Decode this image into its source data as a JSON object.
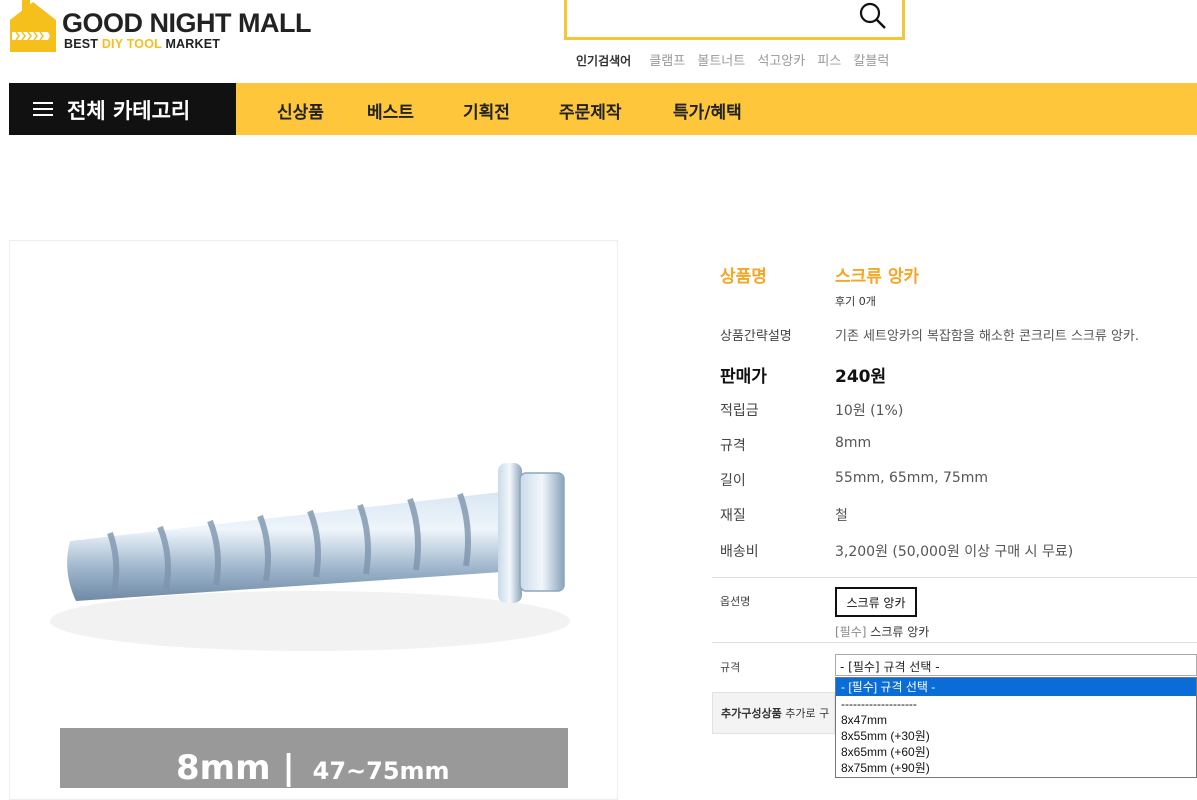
{
  "header": {
    "brand": "GOOD NIGHT MALL",
    "tagline_pre": "BEST ",
    "tagline_hl": "DIY TOOL",
    "tagline_post": " MARKET",
    "search_value": "",
    "popular_label": "인기검색어",
    "popular_keywords": [
      "클램프",
      "볼트너트",
      "석고앙카",
      "피스",
      "칼블럭"
    ]
  },
  "nav": {
    "all_category": "전체 카테고리",
    "items": [
      "신상품",
      "베스트",
      "기획전",
      "주문제작",
      "특가/혜택"
    ]
  },
  "product_image": {
    "banner_main": "8mm",
    "banner_sep": "|",
    "banner_sub": "47~75mm"
  },
  "product": {
    "name_label": "상품명",
    "name": "스크류 앙카",
    "review": "후기 0개",
    "summary_label": "상품간략설명",
    "summary": "기존 세트앙카의 복잡함을 해소한 콘크리트 스크류 앙카.",
    "price_label": "판매가",
    "price": "240원",
    "points_label": "적립금",
    "points": "10원 (1%)",
    "spec_label": "규격",
    "spec": "8mm",
    "length_label": "길이",
    "length": "55mm, 65mm, 75mm",
    "material_label": "재질",
    "material": "철",
    "shipping_label": "배송비",
    "shipping": "3,200원 (50,000원 이상 구매 시 무료)"
  },
  "options": {
    "option_label": "옵션명",
    "option_button": "스크류 앙카",
    "selected_req": "[필수]",
    "selected_name": "스크류 앙카",
    "spec_label": "규격",
    "spec_select_value": "- [필수] 규격 선택 -",
    "dropdown_options": [
      "- [필수] 규격 선택 -",
      "-------------------",
      "8x47mm",
      "8x55mm (+30원)",
      "8x65mm (+60원)",
      "8x75mm (+90원)"
    ],
    "add_label": "추가구성상품",
    "add_text": "추가로 구"
  },
  "colors": {
    "accent_yellow": "#fec63a",
    "name_orange": "#f5a623",
    "dropdown_highlight": "#0a6cd6"
  }
}
